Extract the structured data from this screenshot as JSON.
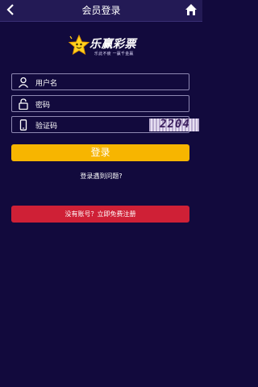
{
  "header": {
    "title": "会员登录",
    "back_icon": "chevron-left-icon",
    "home_icon": "home-icon"
  },
  "logo": {
    "brand": "乐赢彩票",
    "slogan": "乐此不疲  一赢千金赢",
    "icon": "star-mascot-icon"
  },
  "form": {
    "username_placeholder": "用户名",
    "password_placeholder": "密码",
    "captcha_placeholder": "验证码",
    "captcha_code": "2204",
    "login_label": "登录",
    "problem_link": "登录遇到问题?",
    "register_label": "没有账号？立即免费注册"
  },
  "colors": {
    "background": "#120a3d",
    "header": "#231a55",
    "login_button": "#f7b500",
    "register_button": "#cf2036"
  }
}
